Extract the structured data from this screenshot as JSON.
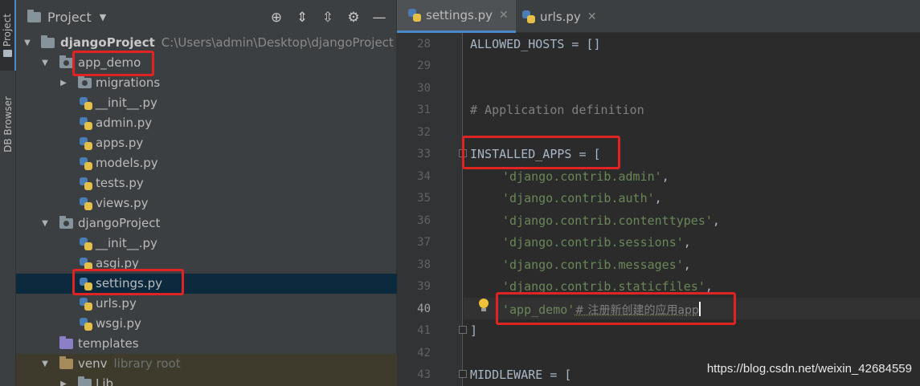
{
  "sidebar": {
    "project_tab": "Project",
    "db_tab": "DB Browser"
  },
  "project_panel": {
    "title": "Project",
    "tool_icons": [
      "locate-icon",
      "expand-all-icon",
      "collapse-all-icon",
      "gear-icon",
      "minimize-icon"
    ],
    "tree": [
      {
        "name": "djangoProject",
        "path": "C:\\Users\\admin\\Desktop\\djangoProject"
      },
      {
        "name": "app_demo"
      },
      {
        "name": "migrations"
      },
      {
        "name": "__init__.py"
      },
      {
        "name": "admin.py"
      },
      {
        "name": "apps.py"
      },
      {
        "name": "models.py"
      },
      {
        "name": "tests.py"
      },
      {
        "name": "views.py"
      },
      {
        "name": "djangoProject"
      },
      {
        "name": "__init__.py"
      },
      {
        "name": "asgi.py"
      },
      {
        "name": "settings.py"
      },
      {
        "name": "urls.py"
      },
      {
        "name": "wsgi.py"
      },
      {
        "name": "templates"
      },
      {
        "name": "venv",
        "hint": "library root"
      },
      {
        "name": "Lib"
      }
    ]
  },
  "editor": {
    "tabs": [
      {
        "label": "settings.py",
        "active": true
      },
      {
        "label": "urls.py",
        "active": false
      }
    ],
    "current_line": 40,
    "lines": [
      {
        "num": "28",
        "code": "ALLOWED_HOSTS = []"
      },
      {
        "num": "29",
        "code": ""
      },
      {
        "num": "30",
        "code": ""
      },
      {
        "num": "31",
        "code": "# Application definition"
      },
      {
        "num": "32",
        "code": ""
      },
      {
        "num": "33",
        "code": "INSTALLED_APPS = ["
      },
      {
        "num": "34",
        "code": "'django.contrib.admin'"
      },
      {
        "num": "35",
        "code": "'django.contrib.auth'"
      },
      {
        "num": "36",
        "code": "'django.contrib.contenttypes'"
      },
      {
        "num": "37",
        "code": "'django.contrib.sessions'"
      },
      {
        "num": "38",
        "code": "'django.contrib.messages'"
      },
      {
        "num": "39",
        "code": "'django.contrib.staticfiles'"
      },
      {
        "num": "40",
        "code": "'app_demo'",
        "comment": "# 注册新创建的应用app"
      },
      {
        "num": "41",
        "code": "]"
      },
      {
        "num": "42",
        "code": ""
      },
      {
        "num": "43",
        "code": "MIDDLEWARE = ["
      }
    ],
    "punct_comma": ","
  },
  "watermark": "https://blog.csdn.net/weixin_42684559",
  "colors": {
    "highlight": "#e02424",
    "string": "#6a8759",
    "comment": "#808080",
    "selection": "#0d293e"
  }
}
